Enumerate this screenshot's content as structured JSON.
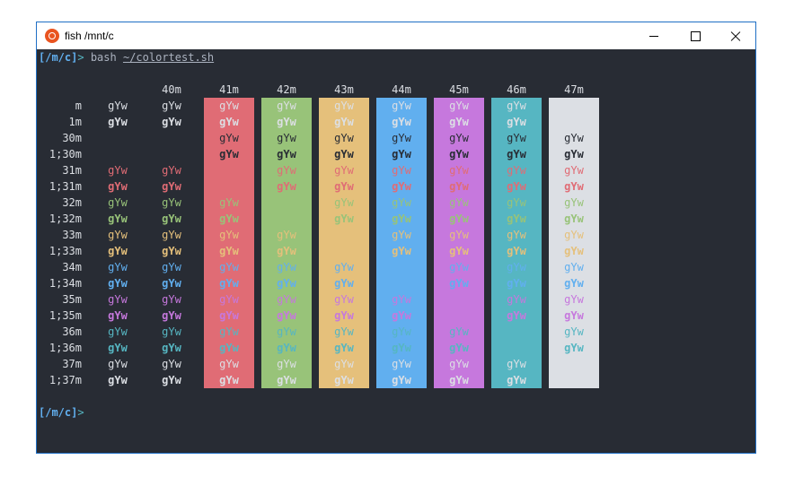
{
  "window": {
    "title": "fish  /mnt/c",
    "app_icon": "ubuntu-icon"
  },
  "prompt": {
    "label": "[/m/c]",
    "arrow": ">",
    "command": "bash",
    "arg": "~/colortest.sh"
  },
  "colortest": {
    "sample": "gYw",
    "bg_headers": [
      "40m",
      "41m",
      "42m",
      "43m",
      "44m",
      "45m",
      "46m",
      "47m"
    ],
    "bg_colors": [
      "#e06c75",
      "#98c379",
      "#e5c07b",
      "#61afef",
      "#c678dd",
      "#56b6c2",
      "#dcdfe4"
    ],
    "rows": [
      {
        "label": "m",
        "fg": "#dcdfe4",
        "bold": false
      },
      {
        "label": "1m",
        "fg": "#dcdfe4",
        "bold": true
      },
      {
        "label": "30m",
        "fg": "#282c34",
        "bold": false
      },
      {
        "label": "1;30m",
        "fg": "#282c34",
        "bold": true
      },
      {
        "label": "31m",
        "fg": "#e06c75",
        "bold": false
      },
      {
        "label": "1;31m",
        "fg": "#e06c75",
        "bold": true
      },
      {
        "label": "32m",
        "fg": "#98c379",
        "bold": false
      },
      {
        "label": "1;32m",
        "fg": "#98c379",
        "bold": true
      },
      {
        "label": "33m",
        "fg": "#e5c07b",
        "bold": false
      },
      {
        "label": "1;33m",
        "fg": "#e5c07b",
        "bold": true
      },
      {
        "label": "34m",
        "fg": "#61afef",
        "bold": false
      },
      {
        "label": "1;34m",
        "fg": "#61afef",
        "bold": true
      },
      {
        "label": "35m",
        "fg": "#c678dd",
        "bold": false
      },
      {
        "label": "1;35m",
        "fg": "#c678dd",
        "bold": true
      },
      {
        "label": "36m",
        "fg": "#56b6c2",
        "bold": false
      },
      {
        "label": "1;36m",
        "fg": "#56b6c2",
        "bold": true
      },
      {
        "label": "37m",
        "fg": "#dcdfe4",
        "bold": false
      },
      {
        "label": "1;37m",
        "fg": "#dcdfe4",
        "bold": true
      }
    ]
  },
  "terminal": {
    "bg": "#282c34"
  }
}
